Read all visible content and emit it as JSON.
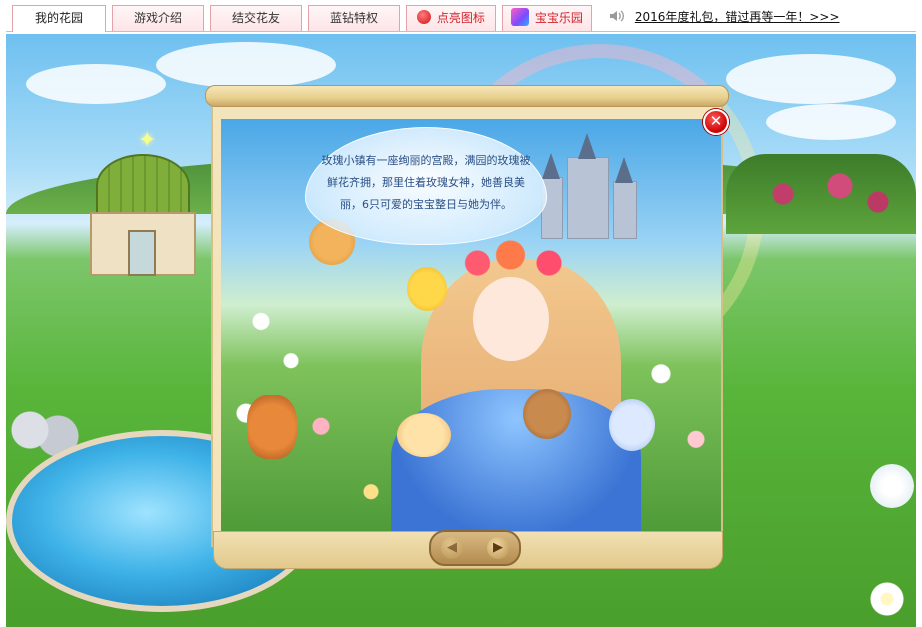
{
  "tabs": [
    {
      "label": "我的花园",
      "active": true
    },
    {
      "label": "游戏介绍",
      "active": false
    },
    {
      "label": "结交花友",
      "active": false
    },
    {
      "label": "蓝钻特权",
      "active": false
    },
    {
      "label": "点亮图标",
      "active": false,
      "icon": "heart-icon"
    },
    {
      "label": "宝宝乐园",
      "active": false,
      "icon": "baby-garden-icon"
    }
  ],
  "announcement": {
    "icon": "speaker-icon",
    "text": "2016年度礼包，错过再等一年！>>>"
  },
  "dialog": {
    "story_text": "玫瑰小镇有一座绚丽的宫殿，满园的玫瑰被鲜花齐拥，那里住着玫瑰女神，她善良美丽，6只可爱的宝宝整日与她为伴。",
    "close_glyph": "✕",
    "prev_glyph": "◀",
    "next_glyph": "▶"
  },
  "colors": {
    "tab_border": "#e3a3a8",
    "accent_red": "#d1232b",
    "scroll_paper": "#f4e4bc"
  }
}
